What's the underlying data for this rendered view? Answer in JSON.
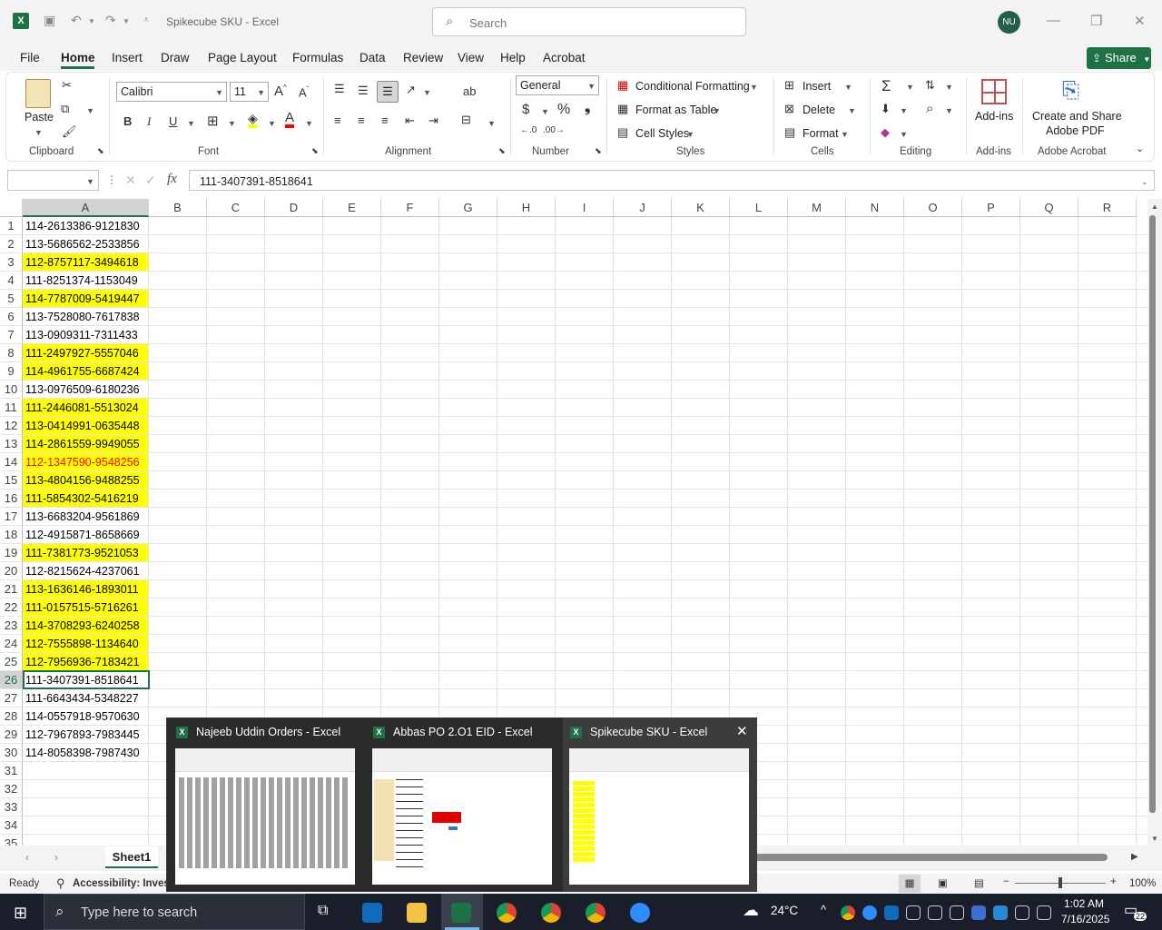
{
  "window": {
    "title": "Spikecube SKU  -  Excel",
    "search_placeholder": "Search",
    "avatar_initials": "NU"
  },
  "menu": [
    "File",
    "Home",
    "Insert",
    "Draw",
    "Page Layout",
    "Formulas",
    "Data",
    "Review",
    "View",
    "Help",
    "Acrobat"
  ],
  "share_label": "Share",
  "ribbon": {
    "clipboard": {
      "paste": "Paste",
      "label": "Clipboard"
    },
    "font": {
      "name": "Calibri",
      "size": "11",
      "label": "Font",
      "bold": "B",
      "italic": "I",
      "underline": "U"
    },
    "alignment": {
      "label": "Alignment"
    },
    "number": {
      "format": "General",
      "label": "Number",
      "currency": "$",
      "percent": "%"
    },
    "styles": {
      "conditional": "Conditional Formatting",
      "format_table": "Format as Table",
      "cell_styles": "Cell Styles",
      "label": "Styles"
    },
    "cells": {
      "insert": "Insert",
      "delete": "Delete",
      "format": "Format",
      "label": "Cells"
    },
    "editing": {
      "label": "Editing"
    },
    "addins": {
      "button": "Add-ins",
      "label": "Add-ins"
    },
    "acrobat": {
      "line1": "Create and Share",
      "line2": "Adobe PDF",
      "label": "Adobe Acrobat"
    }
  },
  "formula_bar": {
    "name_box": "",
    "fx": "fx",
    "value": "111-3407391-8518641"
  },
  "columns": [
    "A",
    "B",
    "C",
    "D",
    "E",
    "F",
    "G",
    "H",
    "I",
    "J",
    "K",
    "L",
    "M",
    "N",
    "O",
    "P",
    "Q",
    "R"
  ],
  "rows": [
    {
      "n": "1",
      "v": "114-2613386-9121830",
      "hl": false,
      "red": false
    },
    {
      "n": "2",
      "v": "113-5686562-2533856",
      "hl": false,
      "red": false
    },
    {
      "n": "3",
      "v": "112-8757117-3494618",
      "hl": true,
      "red": false
    },
    {
      "n": "4",
      "v": "111-8251374-1153049",
      "hl": false,
      "red": false
    },
    {
      "n": "5",
      "v": "114-7787009-5419447",
      "hl": true,
      "red": false
    },
    {
      "n": "6",
      "v": "113-7528080-7617838",
      "hl": false,
      "red": false
    },
    {
      "n": "7",
      "v": "113-0909311-7311433",
      "hl": false,
      "red": false
    },
    {
      "n": "8",
      "v": "111-2497927-5557046",
      "hl": true,
      "red": false
    },
    {
      "n": "9",
      "v": "114-4961755-6687424",
      "hl": true,
      "red": false
    },
    {
      "n": "10",
      "v": "113-0976509-6180236",
      "hl": false,
      "red": false
    },
    {
      "n": "11",
      "v": "111-2446081-5513024",
      "hl": true,
      "red": false
    },
    {
      "n": "12",
      "v": "113-0414991-0635448",
      "hl": true,
      "red": false
    },
    {
      "n": "13",
      "v": "114-2861559-9949055",
      "hl": true,
      "red": false
    },
    {
      "n": "14",
      "v": "112-1347590-9548256",
      "hl": true,
      "red": true
    },
    {
      "n": "15",
      "v": "113-4804156-9488255",
      "hl": true,
      "red": false
    },
    {
      "n": "16",
      "v": "111-5854302-5416219",
      "hl": true,
      "red": false
    },
    {
      "n": "17",
      "v": "113-6683204-9561869",
      "hl": false,
      "red": false
    },
    {
      "n": "18",
      "v": "112-4915871-8658669",
      "hl": false,
      "red": false
    },
    {
      "n": "19",
      "v": "111-7381773-9521053",
      "hl": true,
      "red": false
    },
    {
      "n": "20",
      "v": "112-8215624-4237061",
      "hl": false,
      "red": false
    },
    {
      "n": "21",
      "v": "113-1636146-1893011",
      "hl": true,
      "red": false
    },
    {
      "n": "22",
      "v": "111-0157515-5716261",
      "hl": true,
      "red": false
    },
    {
      "n": "23",
      "v": "114-3708293-6240258",
      "hl": true,
      "red": false
    },
    {
      "n": "24",
      "v": "112-7555898-1134640",
      "hl": true,
      "red": false
    },
    {
      "n": "25",
      "v": "112-7956936-7183421",
      "hl": true,
      "red": false
    },
    {
      "n": "26",
      "v": "111-3407391-8518641",
      "hl": false,
      "red": false
    },
    {
      "n": "27",
      "v": "111-6643434-5348227",
      "hl": false,
      "red": false
    },
    {
      "n": "28",
      "v": "114-0557918-9570630",
      "hl": false,
      "red": false
    },
    {
      "n": "29",
      "v": "112-7967893-7983445",
      "hl": false,
      "red": false
    },
    {
      "n": "30",
      "v": "114-8058398-7987430",
      "hl": false,
      "red": false
    },
    {
      "n": "31",
      "v": "",
      "hl": false,
      "red": false
    },
    {
      "n": "32",
      "v": "",
      "hl": false,
      "red": false
    },
    {
      "n": "33",
      "v": "",
      "hl": false,
      "red": false
    },
    {
      "n": "34",
      "v": "",
      "hl": false,
      "red": false
    },
    {
      "n": "35",
      "v": "",
      "hl": false,
      "red": false
    }
  ],
  "sheet_tab": "Sheet1",
  "status": {
    "ready": "Ready",
    "accessibility": "Accessibility: Investig",
    "zoom": "100%"
  },
  "previews": [
    {
      "title": "Najeeb Uddin Orders - Excel"
    },
    {
      "title": "Abbas PO 2.O1  EID - Excel"
    },
    {
      "title": "Spikecube SKU - Excel"
    }
  ],
  "taskbar": {
    "search_placeholder": "Type here to search",
    "temp": "24°C",
    "time": "1:02 AM",
    "date": "7/16/2025",
    "notif": "22"
  },
  "colors": {
    "accent": "#1e7145",
    "highlight": "#ffff00",
    "red_text": "#ff0000"
  }
}
